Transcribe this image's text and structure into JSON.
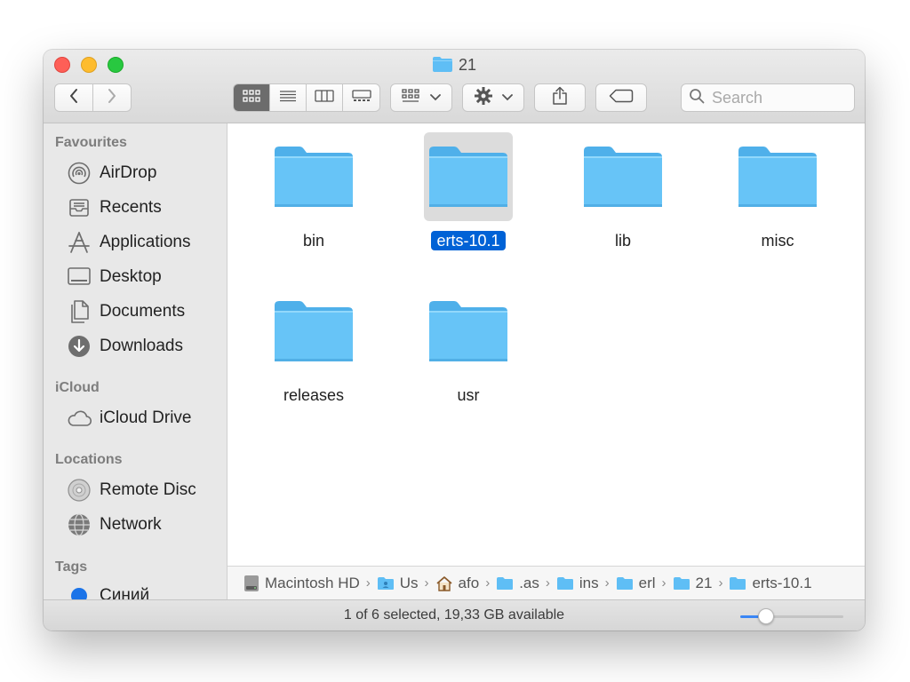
{
  "window": {
    "title": "21",
    "title_icon": "folder-icon",
    "colors": {
      "accent": "#0062d6",
      "folder": "#5fbef5",
      "close": "#fe5f57",
      "minimize": "#febc2e",
      "zoom": "#28c840"
    }
  },
  "toolbar": {
    "back_icon": "chevron-left-icon",
    "forward_icon": "chevron-right-icon",
    "view_modes": [
      "icon-view",
      "list-view",
      "column-view",
      "gallery-view"
    ],
    "active_view": "icon-view",
    "group_icon": "group-by-icon",
    "action_icon": "gear-icon",
    "share_icon": "share-icon",
    "tag_icon": "tag-icon",
    "search_placeholder": "Search"
  },
  "sidebar": {
    "sections": [
      {
        "heading": "Favourites",
        "items": [
          {
            "label": "AirDrop",
            "icon": "airdrop-icon"
          },
          {
            "label": "Recents",
            "icon": "recents-icon"
          },
          {
            "label": "Applications",
            "icon": "applications-icon"
          },
          {
            "label": "Desktop",
            "icon": "desktop-icon"
          },
          {
            "label": "Documents",
            "icon": "documents-icon"
          },
          {
            "label": "Downloads",
            "icon": "downloads-icon"
          }
        ]
      },
      {
        "heading": "iCloud",
        "items": [
          {
            "label": "iCloud Drive",
            "icon": "cloud-icon"
          }
        ]
      },
      {
        "heading": "Locations",
        "items": [
          {
            "label": "Remote Disc",
            "icon": "disc-icon"
          },
          {
            "label": "Network",
            "icon": "globe-icon"
          }
        ]
      },
      {
        "heading": "Tags",
        "items": [
          {
            "label": "Синий",
            "icon": "tag-dot-icon",
            "color": "#1a73e8"
          }
        ]
      }
    ]
  },
  "files": [
    {
      "name": "bin",
      "icon": "folder-icon",
      "selected": false
    },
    {
      "name": "erts-10.1",
      "icon": "folder-icon",
      "selected": true
    },
    {
      "name": "lib",
      "icon": "folder-icon",
      "selected": false
    },
    {
      "name": "misc",
      "icon": "folder-icon",
      "selected": false
    },
    {
      "name": "releases",
      "icon": "folder-icon",
      "selected": false
    },
    {
      "name": "usr",
      "icon": "folder-icon",
      "selected": false
    }
  ],
  "pathbar": [
    {
      "label": "Macintosh HD",
      "icon": "hard-drive-icon"
    },
    {
      "label": "Us",
      "icon": "user-folder-icon"
    },
    {
      "label": "afo",
      "icon": "home-icon"
    },
    {
      "label": ".as",
      "icon": "folder-icon"
    },
    {
      "label": "ins",
      "icon": "folder-icon"
    },
    {
      "label": "erl",
      "icon": "folder-icon"
    },
    {
      "label": "21",
      "icon": "folder-icon"
    },
    {
      "label": "erts-10.1",
      "icon": "folder-icon"
    }
  ],
  "statusbar": {
    "text": "1 of 6 selected, 19,33 GB available",
    "icon_size_level": 0.25
  }
}
